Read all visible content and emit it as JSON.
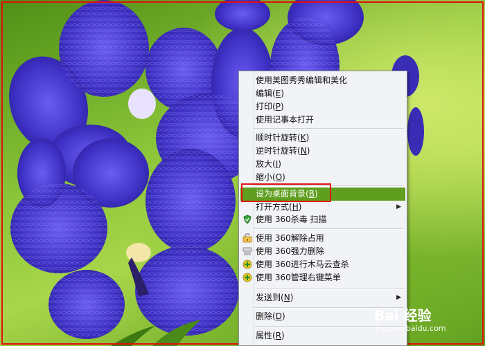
{
  "context_menu": {
    "items": [
      {
        "label": "使用美图秀秀编辑和美化",
        "accel": "",
        "icon": "",
        "submenu": false,
        "highlighted": false
      },
      {
        "label": "编辑",
        "accel": "E",
        "icon": "",
        "submenu": false,
        "highlighted": false
      },
      {
        "label": "打印",
        "accel": "P",
        "icon": "",
        "submenu": false,
        "highlighted": false
      },
      {
        "label": "使用记事本打开",
        "accel": "",
        "icon": "",
        "submenu": false,
        "highlighted": false
      },
      {
        "label": "顺时针旋转",
        "accel": "K",
        "icon": "",
        "submenu": false,
        "highlighted": false
      },
      {
        "label": "逆时针旋转",
        "accel": "N",
        "icon": "",
        "submenu": false,
        "highlighted": false
      },
      {
        "label": "放大",
        "accel": "I",
        "icon": "",
        "submenu": false,
        "highlighted": false
      },
      {
        "label": "缩小",
        "accel": "O",
        "icon": "",
        "submenu": false,
        "highlighted": false
      },
      {
        "label": "设为桌面背景",
        "accel": "B",
        "icon": "",
        "submenu": false,
        "highlighted": true
      },
      {
        "label": "打开方式",
        "accel": "H",
        "icon": "",
        "submenu": true,
        "highlighted": false
      },
      {
        "label": "使用 360杀毒 扫描",
        "accel": "",
        "icon": "360-shield-icon",
        "submenu": false,
        "highlighted": false
      },
      {
        "label": "使用 360解除占用",
        "accel": "",
        "icon": "unlock-icon",
        "submenu": false,
        "highlighted": false
      },
      {
        "label": "使用 360强力删除",
        "accel": "",
        "icon": "shred-icon",
        "submenu": false,
        "highlighted": false
      },
      {
        "label": "使用 360进行木马云查杀",
        "accel": "",
        "icon": "360-plus-icon",
        "submenu": false,
        "highlighted": false
      },
      {
        "label": "使用 360管理右键菜单",
        "accel": "",
        "icon": "360-plus-icon",
        "submenu": false,
        "highlighted": false
      },
      {
        "label": "发送到",
        "accel": "N",
        "icon": "",
        "submenu": true,
        "highlighted": false
      },
      {
        "label": "删除",
        "accel": "D",
        "icon": "",
        "submenu": false,
        "highlighted": false
      },
      {
        "label": "属性",
        "accel": "R",
        "icon": "",
        "submenu": false,
        "highlighted": false
      }
    ]
  },
  "watermark": {
    "logo": "Bai 经验",
    "site": "jingyan.baidu.com"
  },
  "colors": {
    "highlight": "#5f9e1f",
    "annotation": "#e01010",
    "petal": "#4a3ad0"
  }
}
